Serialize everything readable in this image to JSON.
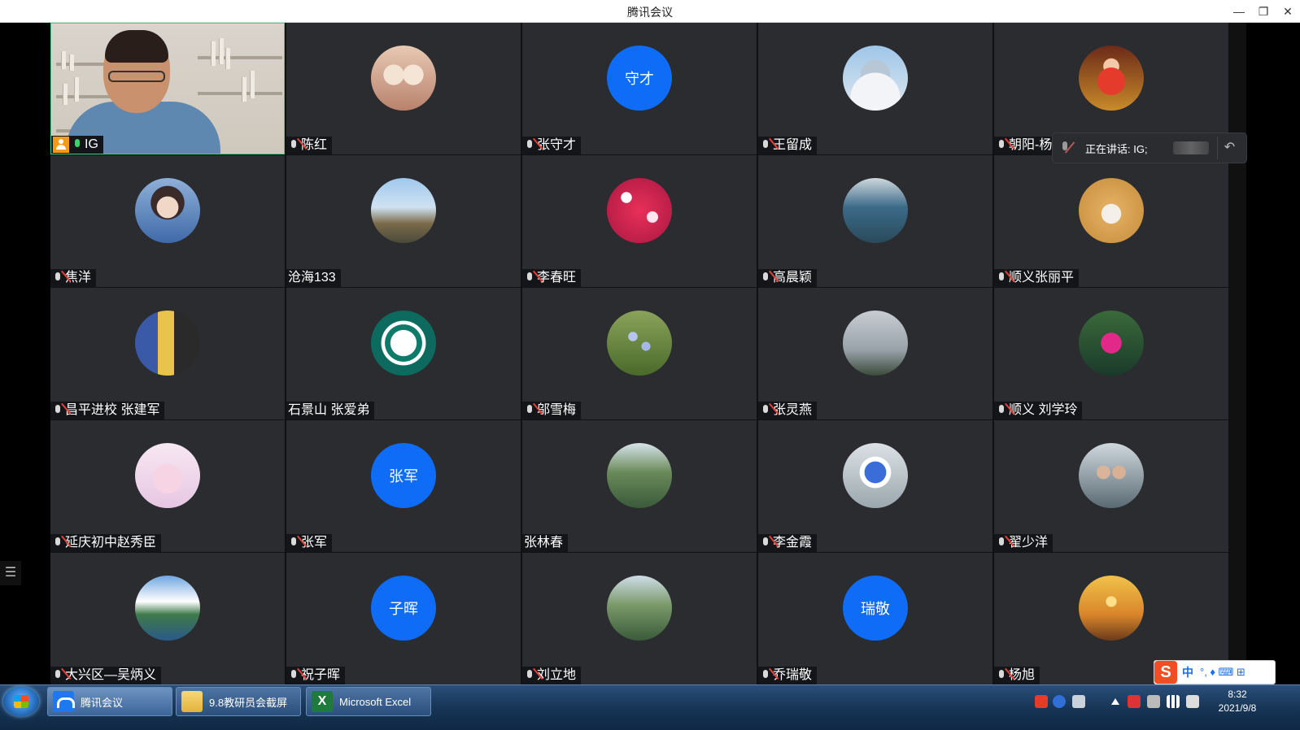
{
  "window": {
    "title": "腾讯会议",
    "minimize": "—",
    "maximize": "❐",
    "close": "✕"
  },
  "participants": [
    {
      "name": "IG",
      "type": "video",
      "mic": "on",
      "host": true
    },
    {
      "name": "陈红",
      "type": "image",
      "mic": "muted",
      "avatar": "av-1"
    },
    {
      "name": "张守才",
      "type": "text",
      "mic": "muted",
      "avatar_text": "守才"
    },
    {
      "name": "王留成",
      "type": "image",
      "mic": "muted",
      "avatar": "av-3"
    },
    {
      "name": "朝阳-杨秀",
      "type": "image",
      "mic": "muted",
      "avatar": "av-4"
    },
    {
      "name": "焦洋",
      "type": "image",
      "mic": "muted",
      "avatar": "av-5"
    },
    {
      "name": "沧海133",
      "type": "image",
      "mic": "none",
      "avatar": "av-6"
    },
    {
      "name": "李春旺",
      "type": "image",
      "mic": "muted",
      "avatar": "av-7"
    },
    {
      "name": "高晨颖",
      "type": "image",
      "mic": "muted",
      "avatar": "av-8"
    },
    {
      "name": "顺义张丽平",
      "type": "image",
      "mic": "muted",
      "avatar": "av-9"
    },
    {
      "name": "昌平进校 张建军",
      "type": "image",
      "mic": "muted",
      "avatar": "av-10"
    },
    {
      "name": "石景山 张爱弟",
      "type": "image",
      "mic": "none",
      "avatar": "av-11"
    },
    {
      "name": "邬雪梅",
      "type": "image",
      "mic": "muted",
      "avatar": "av-12"
    },
    {
      "name": "张灵燕",
      "type": "image",
      "mic": "muted",
      "avatar": "av-13"
    },
    {
      "name": "顺义 刘学玲",
      "type": "image",
      "mic": "muted",
      "avatar": "av-14"
    },
    {
      "name": "延庆初中赵秀臣",
      "type": "image",
      "mic": "muted",
      "avatar": "av-15"
    },
    {
      "name": "张军",
      "type": "text",
      "mic": "muted",
      "avatar_text": "张军"
    },
    {
      "name": "张林春",
      "type": "image",
      "mic": "none",
      "avatar": "av-17"
    },
    {
      "name": "李金霞",
      "type": "image",
      "mic": "muted",
      "avatar": "av-18"
    },
    {
      "name": "翟少洋",
      "type": "image",
      "mic": "muted",
      "avatar": "av-19"
    },
    {
      "name": "大兴区—吴炳义",
      "type": "image",
      "mic": "muted",
      "avatar": "av-20"
    },
    {
      "name": "祝子晖",
      "type": "text",
      "mic": "muted",
      "avatar_text": "子晖"
    },
    {
      "name": "刘立地",
      "type": "image",
      "mic": "muted",
      "avatar": "av-22"
    },
    {
      "name": "乔瑞敬",
      "type": "text",
      "mic": "muted",
      "avatar_text": "瑞敬"
    },
    {
      "name": "杨旭",
      "type": "image",
      "mic": "muted",
      "avatar": "av-24"
    }
  ],
  "speaking_panel": {
    "label": "正在讲话: IG;",
    "pin_icon": "↶"
  },
  "side_list_icon": "☰",
  "ime": {
    "logo": "S",
    "mode": "中",
    "glyphs": "°, ♦ ⌨ ⊞"
  },
  "taskbar": {
    "tasks": [
      {
        "label": "腾讯会议"
      },
      {
        "label": "9.8教研员会截屏"
      },
      {
        "label": "Microsoft Excel"
      }
    ],
    "excel_icon": "X",
    "clock_time": "8:32",
    "clock_date": "2021/9/8"
  }
}
